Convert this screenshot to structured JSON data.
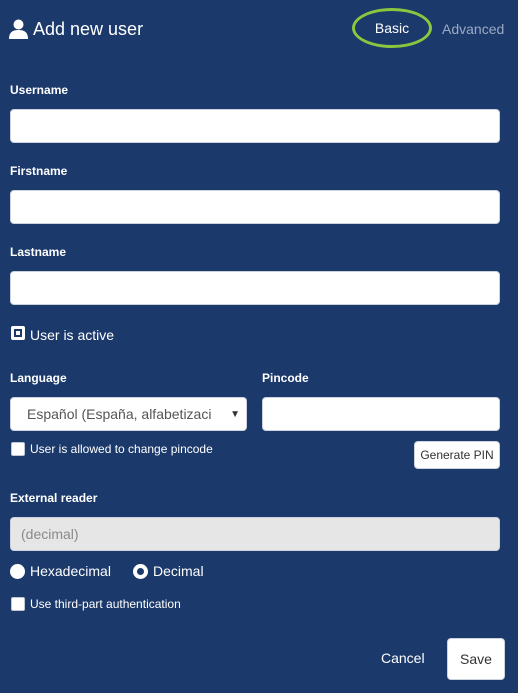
{
  "header": {
    "title": "Add new user",
    "icon": "user-icon",
    "tabs": {
      "basic": "Basic",
      "advanced": "Advanced"
    },
    "active_tab_ring_color": "#8cc63f"
  },
  "form": {
    "username": {
      "label": "Username",
      "value": ""
    },
    "firstname": {
      "label": "Firstname",
      "value": ""
    },
    "lastname": {
      "label": "Lastname",
      "value": ""
    },
    "active": {
      "label": "User is active",
      "checked": true
    },
    "language": {
      "label": "Language",
      "selected": "Español (España, alfabetizaci"
    },
    "pincode": {
      "label": "Pincode",
      "value": ""
    },
    "allow_change_pincode": {
      "label": "User is allowed to change pincode",
      "checked": false
    },
    "generate_pin": {
      "label": "Generate PIN"
    },
    "external_reader": {
      "label": "External reader",
      "placeholder": "(decimal)"
    },
    "format": {
      "options": [
        {
          "label": "Hexadecimal",
          "selected": false
        },
        {
          "label": "Decimal",
          "selected": true
        }
      ]
    },
    "third_party_auth": {
      "label": "Use third-part authentication",
      "checked": false
    }
  },
  "actions": {
    "cancel": "Cancel",
    "save": "Save"
  },
  "colors": {
    "background": "#1b3a6b",
    "text": "#ffffff",
    "muted_tab": "#9aaac4"
  }
}
